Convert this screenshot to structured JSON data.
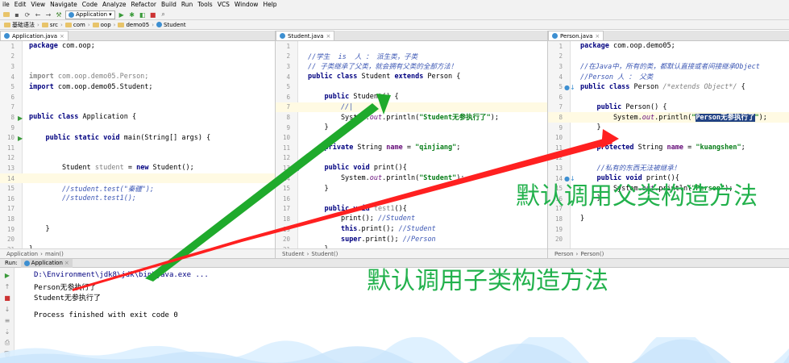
{
  "menu": [
    "ile",
    "Edit",
    "View",
    "Navigate",
    "Code",
    "Analyze",
    "Refactor",
    "Build",
    "Run",
    "Tools",
    "VCS",
    "Window",
    "Help"
  ],
  "toolbar": {
    "run_config": "Application",
    "icons": [
      "folder-icon",
      "save-icon",
      "sync-icon",
      "back-icon",
      "forward-icon",
      "hammer-icon",
      "run-icon",
      "debug-icon",
      "coverage-icon",
      "stop-icon",
      "search-icon"
    ]
  },
  "breadcrumbs": [
    "基础语法",
    "src",
    "com",
    "oop",
    "demo05",
    "Student"
  ],
  "panes": {
    "application": {
      "tab": "Application.java",
      "status": [
        "Application",
        "main()"
      ],
      "lines": [
        {
          "n": "1",
          "t": "package com.oop;"
        },
        {
          "n": "2",
          "t": ""
        },
        {
          "n": "3",
          "t": ""
        },
        {
          "n": "4",
          "t": "import com.oop.demo05.Person;"
        },
        {
          "n": "5",
          "t": "import com.oop.demo05.Student;"
        },
        {
          "n": "6",
          "t": ""
        },
        {
          "n": "7",
          "t": ""
        },
        {
          "n": "8",
          "t": "public class Application {"
        },
        {
          "n": "9",
          "t": ""
        },
        {
          "n": "10",
          "t": "    public static void main(String[] args) {"
        },
        {
          "n": "11",
          "t": ""
        },
        {
          "n": "12",
          "t": ""
        },
        {
          "n": "13",
          "t": "        Student student = new Student();"
        },
        {
          "n": "14",
          "t": ""
        },
        {
          "n": "15",
          "t": "        //student.test(\"秦疆\");"
        },
        {
          "n": "16",
          "t": "        //student.test1();"
        },
        {
          "n": "17",
          "t": ""
        },
        {
          "n": "18",
          "t": ""
        },
        {
          "n": "19",
          "t": "    }"
        },
        {
          "n": "20",
          "t": ""
        },
        {
          "n": "21",
          "t": "}"
        }
      ]
    },
    "student": {
      "tab": "Student.java",
      "status": [
        "Student",
        "Student()"
      ],
      "lines": [
        {
          "n": "1",
          "t": ""
        },
        {
          "n": "2",
          "t": "//学生  is  人 ： 派生类，子类"
        },
        {
          "n": "3",
          "t": "// 子类继承了父类，就会拥有父类的全部方法！"
        },
        {
          "n": "4",
          "t": "public class Student extends Person {"
        },
        {
          "n": "5",
          "t": ""
        },
        {
          "n": "6",
          "t": "    public Student() {"
        },
        {
          "n": "7",
          "t": "        //|"
        },
        {
          "n": "8",
          "t": "        System.out.println(\"Student无参执行了\");"
        },
        {
          "n": "9",
          "t": "    }"
        },
        {
          "n": "10",
          "t": ""
        },
        {
          "n": "11",
          "t": "    private String name = \"qinjiang\";"
        },
        {
          "n": "12",
          "t": ""
        },
        {
          "n": "13",
          "t": "    public void print(){"
        },
        {
          "n": "14",
          "t": "        System.out.println(\"Student\");"
        },
        {
          "n": "15",
          "t": "    }"
        },
        {
          "n": "16",
          "t": ""
        },
        {
          "n": "17",
          "t": "    public void test1(){"
        },
        {
          "n": "18",
          "t": "        print(); //Student"
        },
        {
          "n": "19",
          "t": "        this.print(); //Student"
        },
        {
          "n": "20",
          "t": "        super.print(); //Person"
        },
        {
          "n": "21",
          "t": "    }"
        }
      ]
    },
    "person": {
      "tab": "Person.java",
      "status": [
        "Person",
        "Person()"
      ],
      "lines": [
        {
          "n": "1",
          "t": "package com.oop.demo05;"
        },
        {
          "n": "2",
          "t": ""
        },
        {
          "n": "3",
          "t": "//在Java中，所有的类，都默认直接或者间接继承Object"
        },
        {
          "n": "4",
          "t": "//Person 人 ： 父类"
        },
        {
          "n": "5",
          "t": "public class Person /*extends Object*/ {"
        },
        {
          "n": "6",
          "t": ""
        },
        {
          "n": "7",
          "t": "    public Person() {"
        },
        {
          "n": "8",
          "t": "        System.out.println(\"Person无参执行了\");"
        },
        {
          "n": "9",
          "t": "    }"
        },
        {
          "n": "10",
          "t": ""
        },
        {
          "n": "11",
          "t": "    protected String name = \"kuangshen\";"
        },
        {
          "n": "12",
          "t": ""
        },
        {
          "n": "13",
          "t": "    //私有的东西无法被继承！"
        },
        {
          "n": "14",
          "t": "    public void print(){"
        },
        {
          "n": "15",
          "t": "        System.out.println(\"Person\");"
        },
        {
          "n": "16",
          "t": "    }"
        },
        {
          "n": "17",
          "t": ""
        },
        {
          "n": "18",
          "t": "}"
        },
        {
          "n": "19",
          "t": ""
        },
        {
          "n": "20",
          "t": ""
        }
      ]
    }
  },
  "run": {
    "label": "Run:",
    "tab": "Application",
    "output": [
      "D:\\Environment\\jdk8\\jdk\\bin\\java.exe ...",
      "Person无参执行了",
      "Student无参执行了",
      "",
      "Process finished with exit code 0"
    ]
  },
  "annotations": {
    "parent": "默认调用父类构造方法",
    "child": "默认调用子类构造方法"
  },
  "colors": {
    "annotation_green": "#22b14c",
    "arrow_green": "#1faa2c",
    "arrow_red": "#ff2020"
  }
}
